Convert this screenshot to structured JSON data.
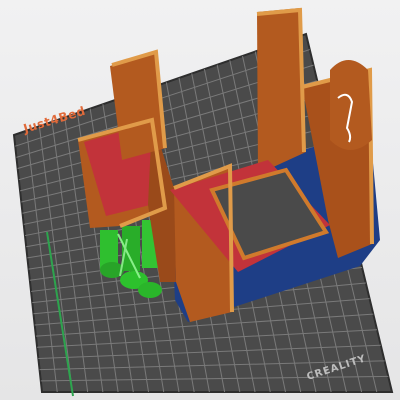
{
  "viewport": {
    "plate_text": "Just4Bed",
    "brand_text": "CREALITY"
  },
  "colors": {
    "background": "#e9e9ea",
    "plate": "#4a4a4a",
    "plate_edge": "#333333",
    "grid_line": "#7a7a7a",
    "model_wall": "#b35a1f",
    "model_wall_dark": "#8e4516",
    "model_top": "#d07a2c",
    "infill_red": "#c2333a",
    "brim_blue": "#1e3e86",
    "support_green": "#2fbf2f",
    "axis_green": "#2da44e",
    "plate_text": "#e06a3a",
    "brand_text": "#bdbdbd"
  },
  "icons": {
    "seam": "seam-marker-icon"
  }
}
